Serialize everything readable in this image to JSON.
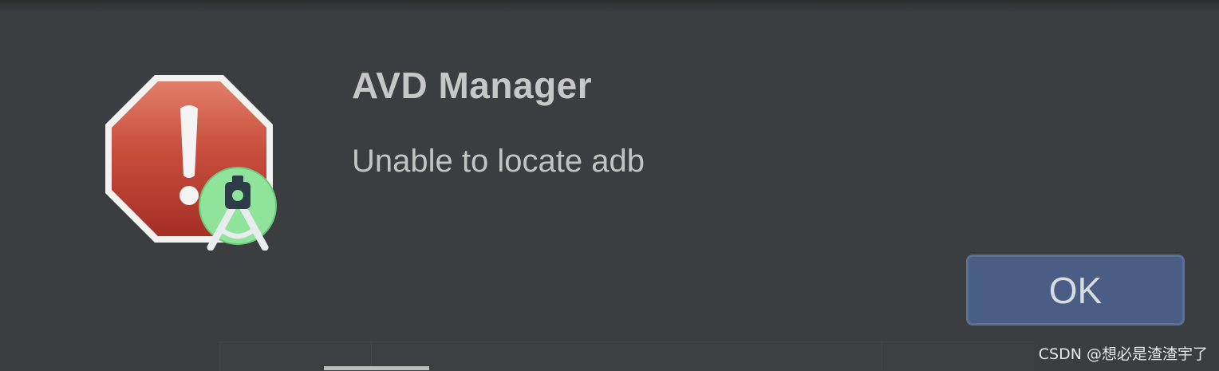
{
  "dialog": {
    "title": "AVD Manager",
    "message": "Unable to locate adb",
    "ok_label": "OK",
    "icon": "error-stop-sign-icon",
    "badge_icon": "android-studio-icon"
  },
  "watermark": "CSDN @想必是渣渣宇了",
  "colors": {
    "background": "#3c3d40",
    "stop_sign": "#c0463a",
    "button": "#4a5e85",
    "badge_green": "#7fd88a"
  }
}
